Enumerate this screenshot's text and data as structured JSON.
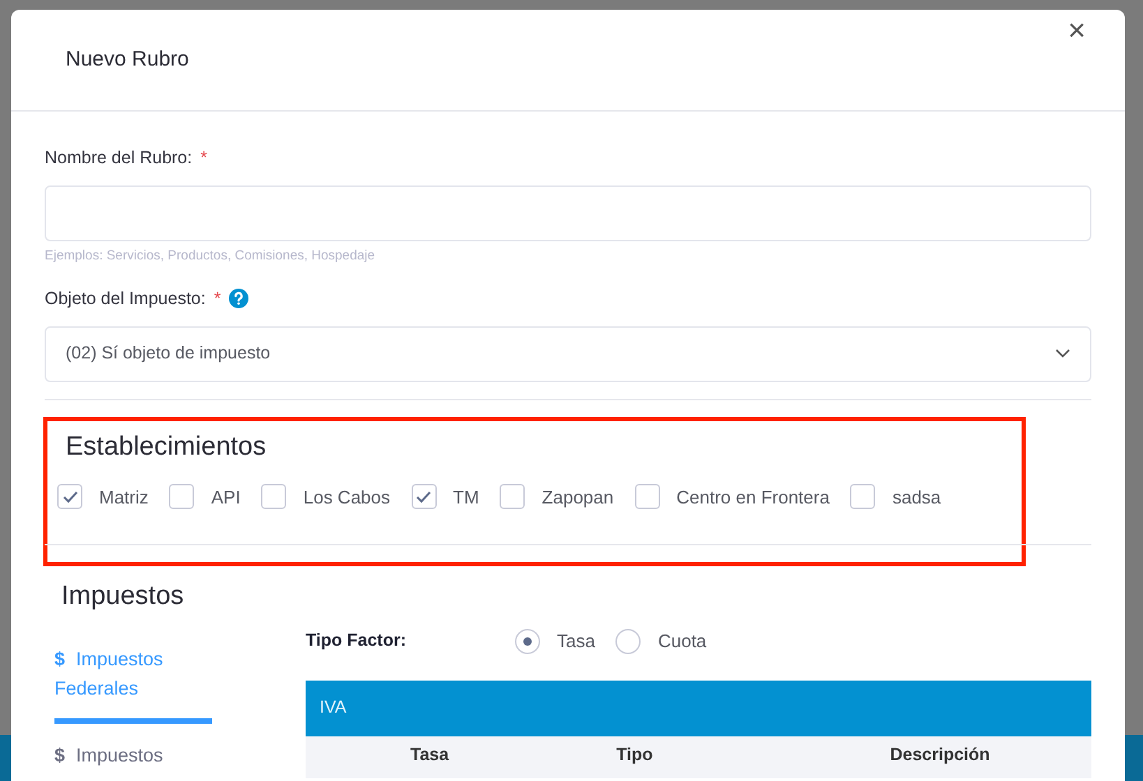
{
  "modal": {
    "title": "Nuevo Rubro",
    "close": "×"
  },
  "nombre": {
    "label": "Nombre del Rubro:",
    "required": "*",
    "help": "Ejemplos: Servicios, Productos, Comisiones, Hospedaje"
  },
  "objeto": {
    "label": "Objeto del Impuesto:",
    "required": "*",
    "value": "(02) Sí objeto de impuesto"
  },
  "establecimientos": {
    "title": "Establecimientos",
    "items": [
      {
        "label": "Matriz",
        "checked": true
      },
      {
        "label": "API",
        "checked": false
      },
      {
        "label": "Los Cabos",
        "checked": false
      },
      {
        "label": "TM",
        "checked": true
      },
      {
        "label": "Zapopan",
        "checked": false
      },
      {
        "label": "Centro en Frontera",
        "checked": false
      },
      {
        "label": "sadsa",
        "checked": false
      }
    ]
  },
  "impuestos": {
    "title": "Impuestos",
    "tabs": [
      {
        "icon": "$",
        "label": "Impuestos Federales",
        "selected": true
      },
      {
        "icon": "$",
        "label": "Impuestos",
        "selected": false
      }
    ],
    "tipo_factor": {
      "label": "Tipo Factor:",
      "options": [
        {
          "label": "Tasa",
          "selected": true
        },
        {
          "label": "Cuota",
          "selected": false
        }
      ]
    },
    "table": {
      "title": "IVA",
      "columns": [
        "Tasa",
        "Tipo",
        "Descripción"
      ]
    }
  }
}
